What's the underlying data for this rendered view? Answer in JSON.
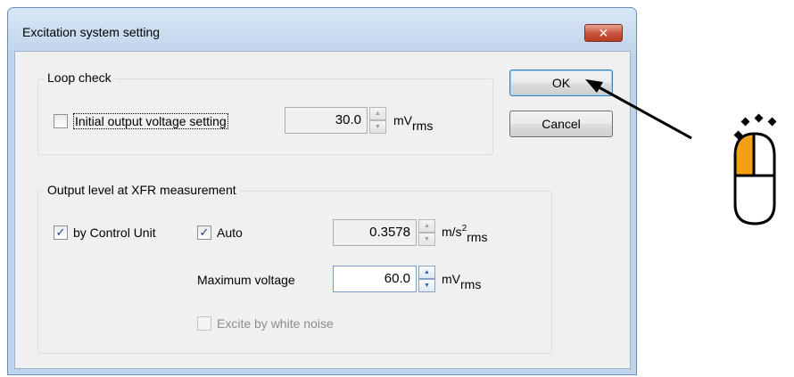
{
  "dialog": {
    "title": "Excitation system setting",
    "close_glyph": "✕"
  },
  "loop_check": {
    "legend": "Loop check",
    "checkbox_label": "Initial output voltage setting",
    "checked": false,
    "value": "30.0",
    "unit_main": "mV",
    "unit_sub": "rms"
  },
  "output_level": {
    "legend": "Output level at XFR measurement",
    "by_control_unit_label": "by Control Unit",
    "by_control_unit_checked": true,
    "auto_label": "Auto",
    "auto_checked": true,
    "accel_value": "0.3578",
    "accel_unit_main": "m/s",
    "accel_unit_sup": "2",
    "accel_unit_sub": "rms",
    "max_voltage_label": "Maximum voltage",
    "max_voltage_value": "60.0",
    "max_voltage_unit_main": "mV",
    "max_voltage_unit_sub": "rms",
    "white_noise_label": "Excite by white noise",
    "white_noise_checked": false
  },
  "buttons": {
    "ok_label": "OK",
    "cancel_label": "Cancel"
  },
  "icons": {
    "checkmark": "✓",
    "spin_up": "▲",
    "spin_down": "▼",
    "mouse_icon": "mouse-left-click-icon",
    "arrow": "pointer-arrow"
  },
  "colors": {
    "title_bar": "#bfd3ea",
    "close_button": "#c7513a",
    "mouse_left_button": "#f5a011"
  }
}
